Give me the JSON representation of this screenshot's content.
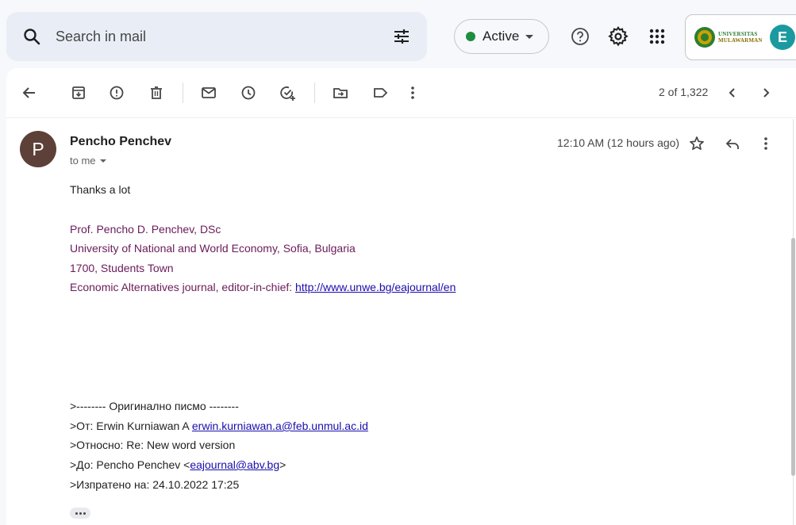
{
  "search": {
    "placeholder": "Search in mail"
  },
  "status": {
    "label": "Active",
    "color": "#1e8e3e"
  },
  "account": {
    "avatar_letter": "E",
    "logo_line1": "UNIVERSITAS",
    "logo_line2": "MULAWARMAN"
  },
  "toolbar": {
    "icons": [
      "back-arrow-icon",
      "archive-icon",
      "report-spam-icon",
      "delete-icon",
      "mark-unread-icon",
      "snooze-icon",
      "add-to-tasks-icon",
      "move-to-icon",
      "label-icon",
      "more-vert-icon"
    ],
    "pager": "2 of 1,322"
  },
  "message": {
    "sender_initial": "P",
    "sender_name": "Pencho Penchev",
    "recipient": "to me",
    "timestamp": "12:10 AM (12 hours ago)",
    "greeting": "Thanks a lot",
    "signature": {
      "line1": "Prof. Pencho D. Penchev, DSc",
      "line2": "University of National and World Economy, Sofia, Bulgaria",
      "line3": "1700, Students Town",
      "line4_prefix": "Economic Alternatives journal, editor-in-chief: ",
      "line4_link": "http://www.unwe.bg/eajournal/en"
    },
    "quoted": {
      "header": ">-------- Оригинално писмо --------",
      "from_prefix": ">От: Erwin Kurniawan A ",
      "from_link": "erwin.kurniawan.a@feb.unmul.ac.id",
      "subject": ">Относно: Re: New word version",
      "to_prefix": ">До: Pencho Penchev <",
      "to_link": "eajournal@abv.bg",
      "to_suffix": ">",
      "sent": ">Изпратено на: 24.10.2022 17:25"
    }
  },
  "colors": {
    "signature": "#6a1b5a",
    "link": "#1a0dab",
    "sender_avatar": "#5d4037",
    "account_avatar": "#1a9aa0"
  }
}
